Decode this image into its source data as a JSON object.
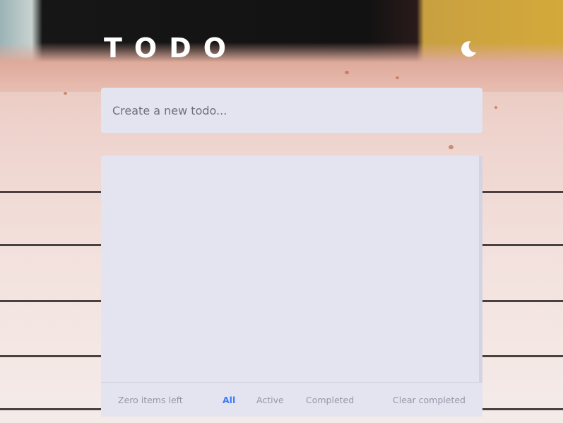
{
  "header": {
    "title": "TODO",
    "theme_toggle_icon": "moon-icon"
  },
  "new_todo": {
    "placeholder": "Create a new todo...",
    "value": ""
  },
  "todos": [],
  "footer": {
    "items_left": "Zero items left",
    "filters": [
      {
        "label": "All",
        "active": true
      },
      {
        "label": "Active",
        "active": false
      },
      {
        "label": "Completed",
        "active": false
      }
    ],
    "clear_label": "Clear completed"
  },
  "colors": {
    "panel": "#e4e4f1",
    "accent": "#3a7bfd",
    "muted_text": "#9695a6",
    "title": "#ffffff"
  }
}
